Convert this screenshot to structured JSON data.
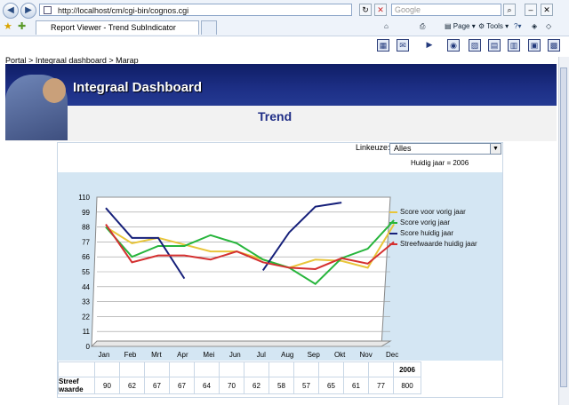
{
  "browser": {
    "url": "http://localhost/cm/cgi-bin/cognos.cgi",
    "search_placeholder": "Google",
    "tab_title": "Report Viewer - Trend SubIndicator",
    "menu": {
      "page": "Page",
      "tools": "Tools"
    }
  },
  "breadcrumb": {
    "item1": "Portal",
    "sep": ">",
    "item2": "Integraal dashboard",
    "item3": "Marap"
  },
  "banner": {
    "title": "Integraal Dashboard"
  },
  "heading": "Trend",
  "filters": {
    "label": "Linkeuze:",
    "selected": "Alles",
    "huidig_jaar": "Huidig jaar = 2006"
  },
  "chart_data": {
    "type": "line",
    "categories": [
      "Jan",
      "Feb",
      "Mrt",
      "Apr",
      "Mei",
      "Jun",
      "Jul",
      "Aug",
      "Sep",
      "Okt",
      "Nov",
      "Dec"
    ],
    "yticks": [
      0,
      11,
      22,
      33,
      44,
      55,
      66,
      77,
      88,
      99,
      110
    ],
    "ylim": [
      0,
      110
    ],
    "series": [
      {
        "name": "Score voor vorig jaar",
        "color": "#e8c53a",
        "values": [
          88,
          76,
          80,
          75,
          70,
          70,
          64,
          58,
          64,
          63,
          58,
          90
        ]
      },
      {
        "name": "Score vorig jaar",
        "color": "#27b53c",
        "values": [
          88,
          66,
          74,
          74,
          82,
          76,
          64,
          58,
          46,
          65,
          72,
          93
        ]
      },
      {
        "name": "Score huidig jaar",
        "color": "#16207a",
        "values": [
          102,
          80,
          80,
          50,
          null,
          null,
          56,
          84,
          103,
          106,
          null,
          null
        ]
      },
      {
        "name": "Streefwaarde huidig jaar",
        "color": "#d43030",
        "values": [
          90,
          62,
          67,
          67,
          64,
          70,
          62,
          58,
          57,
          65,
          61,
          77
        ]
      }
    ]
  },
  "streef_table": {
    "row_label": "Streef waarde",
    "year_header": "2006",
    "values": [
      "90",
      "62",
      "67",
      "67",
      "64",
      "70",
      "62",
      "58",
      "57",
      "65",
      "61",
      "77"
    ],
    "total": "800"
  }
}
